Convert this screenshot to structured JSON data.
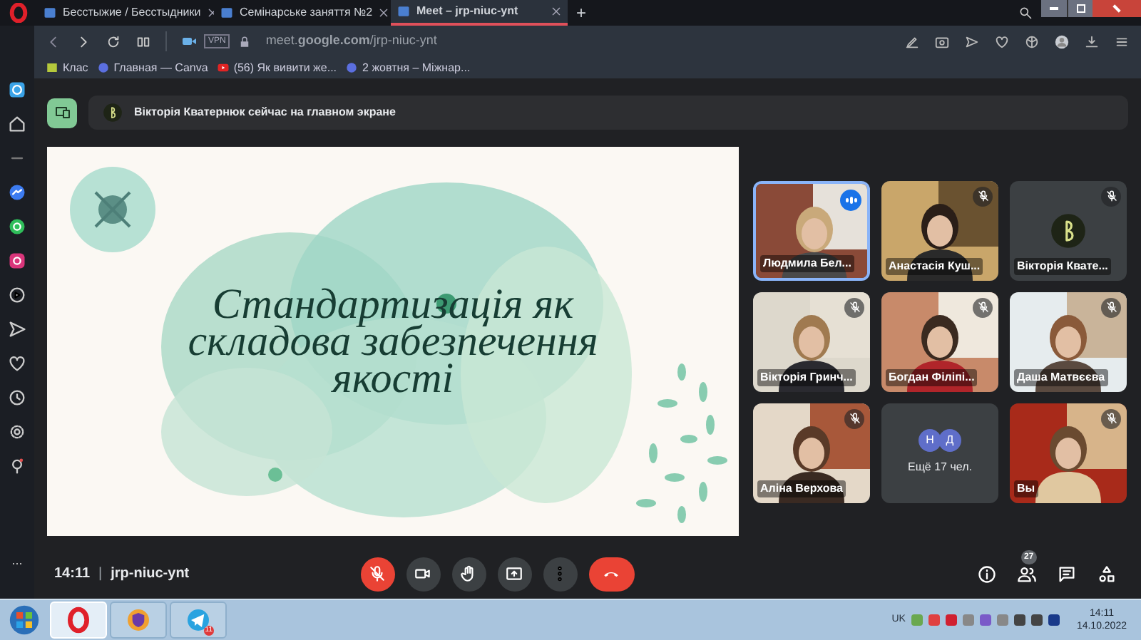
{
  "browser": {
    "tabs": [
      {
        "label": "Бесстыжие / Бесстыдники",
        "selected": false
      },
      {
        "label": "Семінарське заняття №2",
        "selected": false
      },
      {
        "label": "Meet – jrp-niuc-ynt",
        "selected": true
      }
    ],
    "new_tab": "+",
    "vpn": "VPN",
    "url": "meet.**google.com**/jrp-niuc-ynt",
    "bookmarks": [
      "Клас",
      "Главная — Canva",
      "(56) Як вивити же...",
      "2 жовтня – Міжнар..."
    ]
  },
  "meet": {
    "presenter_notice": "Вікторія Кватернюк сейчас на главном экране",
    "slide": {
      "title": "Стандартизація як складова забезпечення якості"
    },
    "tiles": [
      {
        "kind": "video",
        "name": "Людмила Бел...",
        "muted": false,
        "speaking": true
      },
      {
        "kind": "video",
        "name": "Анастасія Куш...",
        "muted": true,
        "speaking": false
      },
      {
        "kind": "avatar",
        "name": "Вікторія Квате...",
        "muted": true,
        "speaking": false
      },
      {
        "kind": "video",
        "name": "Вікторія Гринч...",
        "muted": true,
        "speaking": false
      },
      {
        "kind": "video",
        "name": "Богдан Філіпі...",
        "muted": true,
        "speaking": false
      },
      {
        "kind": "video",
        "name": "Даша Матвєєва",
        "muted": true,
        "speaking": false
      },
      {
        "kind": "video",
        "name": "Аліна Верхова",
        "muted": true,
        "speaking": false
      },
      {
        "kind": "others",
        "initials": [
          "Н",
          "Д"
        ],
        "name": "Ещё 17 чел.",
        "muted": false,
        "speaking": false
      },
      {
        "kind": "video",
        "name": "Вы",
        "muted": true,
        "speaking": false
      }
    ],
    "time": "14:11",
    "separator": "|",
    "meeting_code": "jrp-niuc-ynt",
    "controls": [
      {
        "kind": "mic",
        "alert": true
      },
      {
        "kind": "camera",
        "alert": false
      },
      {
        "kind": "hand",
        "alert": false
      },
      {
        "kind": "present",
        "alert": false
      },
      {
        "kind": "more",
        "alert": false
      },
      {
        "kind": "hangup",
        "alert": true
      }
    ],
    "people_count": "27"
  },
  "sidebar_more": "...",
  "taskbar": {
    "apps": [
      {
        "kind": "opera",
        "selected": true
      },
      {
        "kind": "browser",
        "selected": false
      },
      {
        "kind": "telegram",
        "selected": false,
        "badge": "11"
      }
    ],
    "language": "UK",
    "clock": "14:11",
    "date": "14.10.2022"
  }
}
